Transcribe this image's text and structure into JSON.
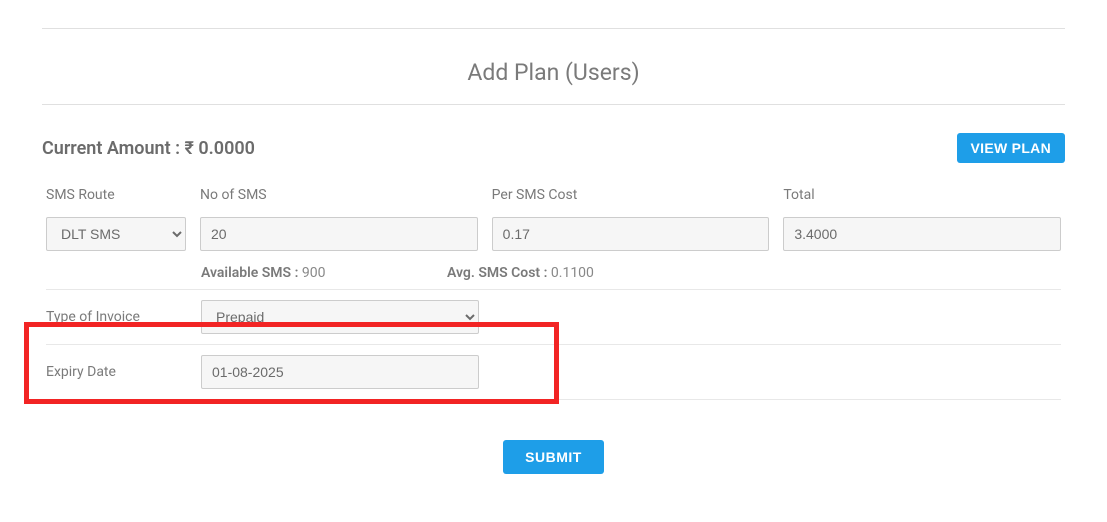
{
  "page": {
    "title": "Add Plan (Users)"
  },
  "header": {
    "current_amount_label": "Current Amount : ₹ 0.0000",
    "view_plan_label": "VIEW PLAN"
  },
  "columns": {
    "sms_route_label": "SMS Route",
    "no_of_sms_label": "No of SMS",
    "per_sms_cost_label": "Per SMS Cost",
    "total_label": "Total"
  },
  "values": {
    "sms_route_selected": "DLT SMS",
    "no_of_sms": "20",
    "per_sms_cost": "0.17",
    "total": "3.4000"
  },
  "info": {
    "available_sms_label": "Available SMS : ",
    "available_sms_value": "900",
    "avg_sms_cost_full_label": "Avg. SMS Cost : ",
    "avg_sms_cost_value": "0.1100"
  },
  "lower": {
    "type_of_invoice_label": "Type of Invoice",
    "type_of_invoice_selected": "Prepaid",
    "expiry_date_label": "Expiry Date",
    "expiry_date_value": "01-08-2025"
  },
  "submit": {
    "label": "SUBMIT"
  }
}
